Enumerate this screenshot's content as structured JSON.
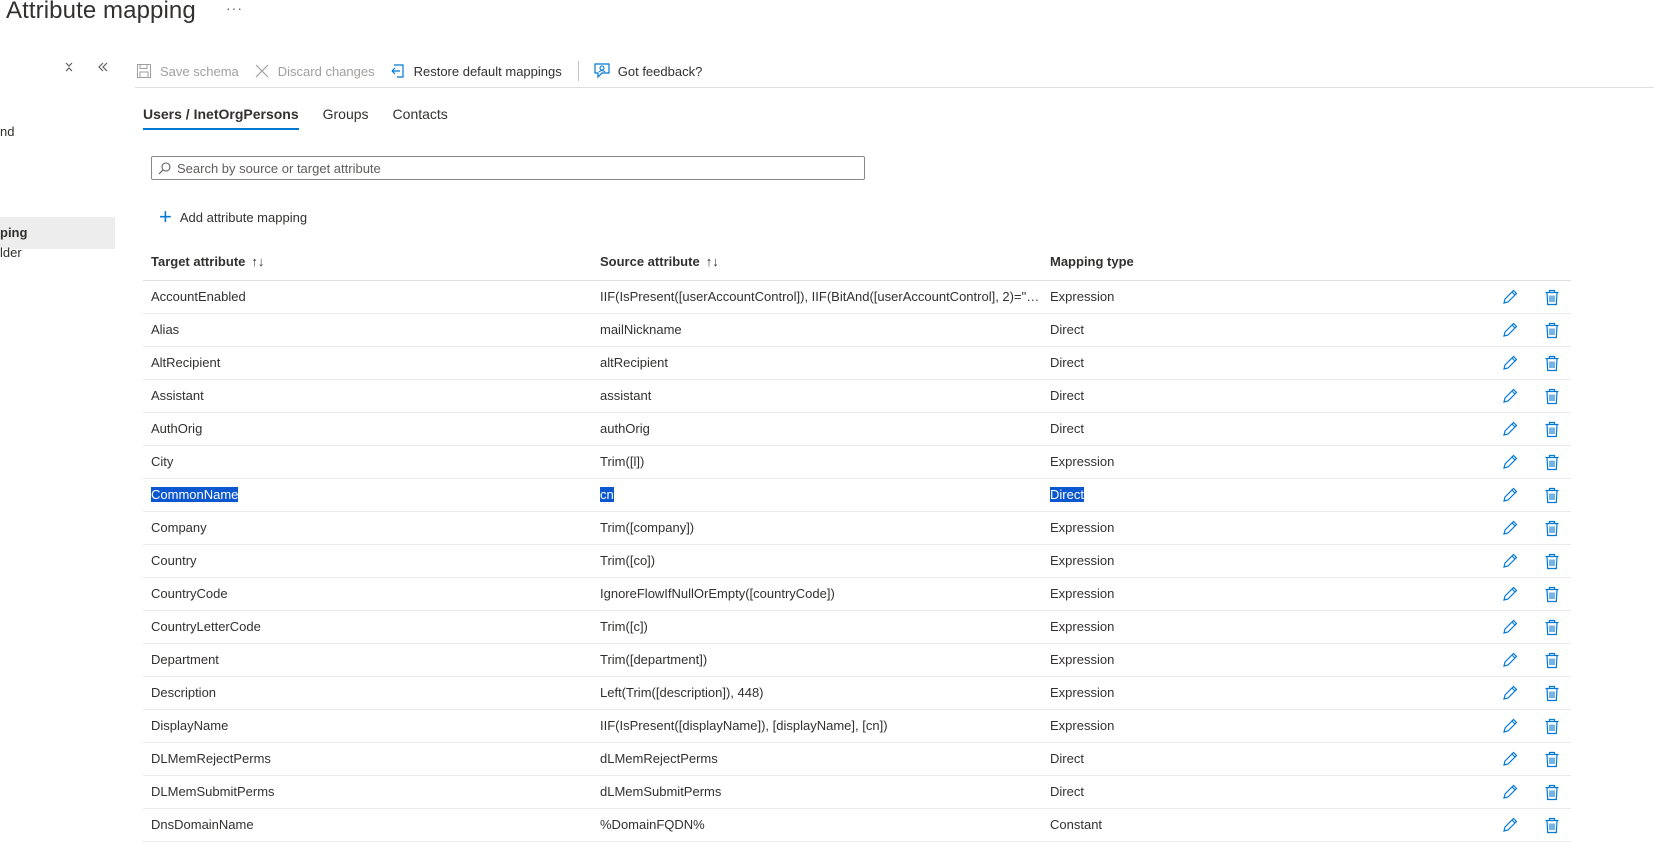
{
  "page": {
    "title": "Attribute mapping",
    "more_label": "···"
  },
  "sidebar": {
    "items": [
      {
        "label": "nd"
      },
      {
        "label": "ping"
      },
      {
        "label": "lder"
      }
    ]
  },
  "toolbar": {
    "save_label": "Save schema",
    "discard_label": "Discard changes",
    "restore_label": "Restore default mappings",
    "feedback_label": "Got feedback?"
  },
  "tabs": [
    {
      "label": "Users / InetOrgPersons",
      "active": true
    },
    {
      "label": "Groups",
      "active": false
    },
    {
      "label": "Contacts",
      "active": false
    }
  ],
  "search": {
    "placeholder": "Search by source or target attribute",
    "value": ""
  },
  "add_mapping": {
    "label": "Add attribute mapping"
  },
  "table": {
    "headers": {
      "target": "Target attribute",
      "source": "Source attribute",
      "type": "Mapping type",
      "sort_icon": "↑↓"
    },
    "rows": [
      {
        "target": "AccountEnabled",
        "source": "IIF(IsPresent([userAccountControl]), IIF(BitAnd([userAccountControl], 2)=\"0\"...",
        "type": "Expression"
      },
      {
        "target": "Alias",
        "source": "mailNickname",
        "type": "Direct"
      },
      {
        "target": "AltRecipient",
        "source": "altRecipient",
        "type": "Direct"
      },
      {
        "target": "Assistant",
        "source": "assistant",
        "type": "Direct"
      },
      {
        "target": "AuthOrig",
        "source": "authOrig",
        "type": "Direct"
      },
      {
        "target": "City",
        "source": "Trim([l])",
        "type": "Expression"
      },
      {
        "target": "CommonName",
        "source": "cn",
        "type": "Direct",
        "selected": true
      },
      {
        "target": "Company",
        "source": "Trim([company])",
        "type": "Expression"
      },
      {
        "target": "Country",
        "source": "Trim([co])",
        "type": "Expression"
      },
      {
        "target": "CountryCode",
        "source": "IgnoreFlowIfNullOrEmpty([countryCode])",
        "type": "Expression"
      },
      {
        "target": "CountryLetterCode",
        "source": "Trim([c])",
        "type": "Expression"
      },
      {
        "target": "Department",
        "source": "Trim([department])",
        "type": "Expression"
      },
      {
        "target": "Description",
        "source": "Left(Trim([description]), 448)",
        "type": "Expression"
      },
      {
        "target": "DisplayName",
        "source": "IIF(IsPresent([displayName]), [displayName], [cn])",
        "type": "Expression"
      },
      {
        "target": "DLMemRejectPerms",
        "source": "dLMemRejectPerms",
        "type": "Direct"
      },
      {
        "target": "DLMemSubmitPerms",
        "source": "dLMemSubmitPerms",
        "type": "Direct"
      },
      {
        "target": "DnsDomainName",
        "source": "%DomainFQDN%",
        "type": "Constant"
      }
    ]
  },
  "colors": {
    "accent": "#0078d4",
    "selection": "#0b57d0",
    "disabled_text": "#a19f9d"
  }
}
